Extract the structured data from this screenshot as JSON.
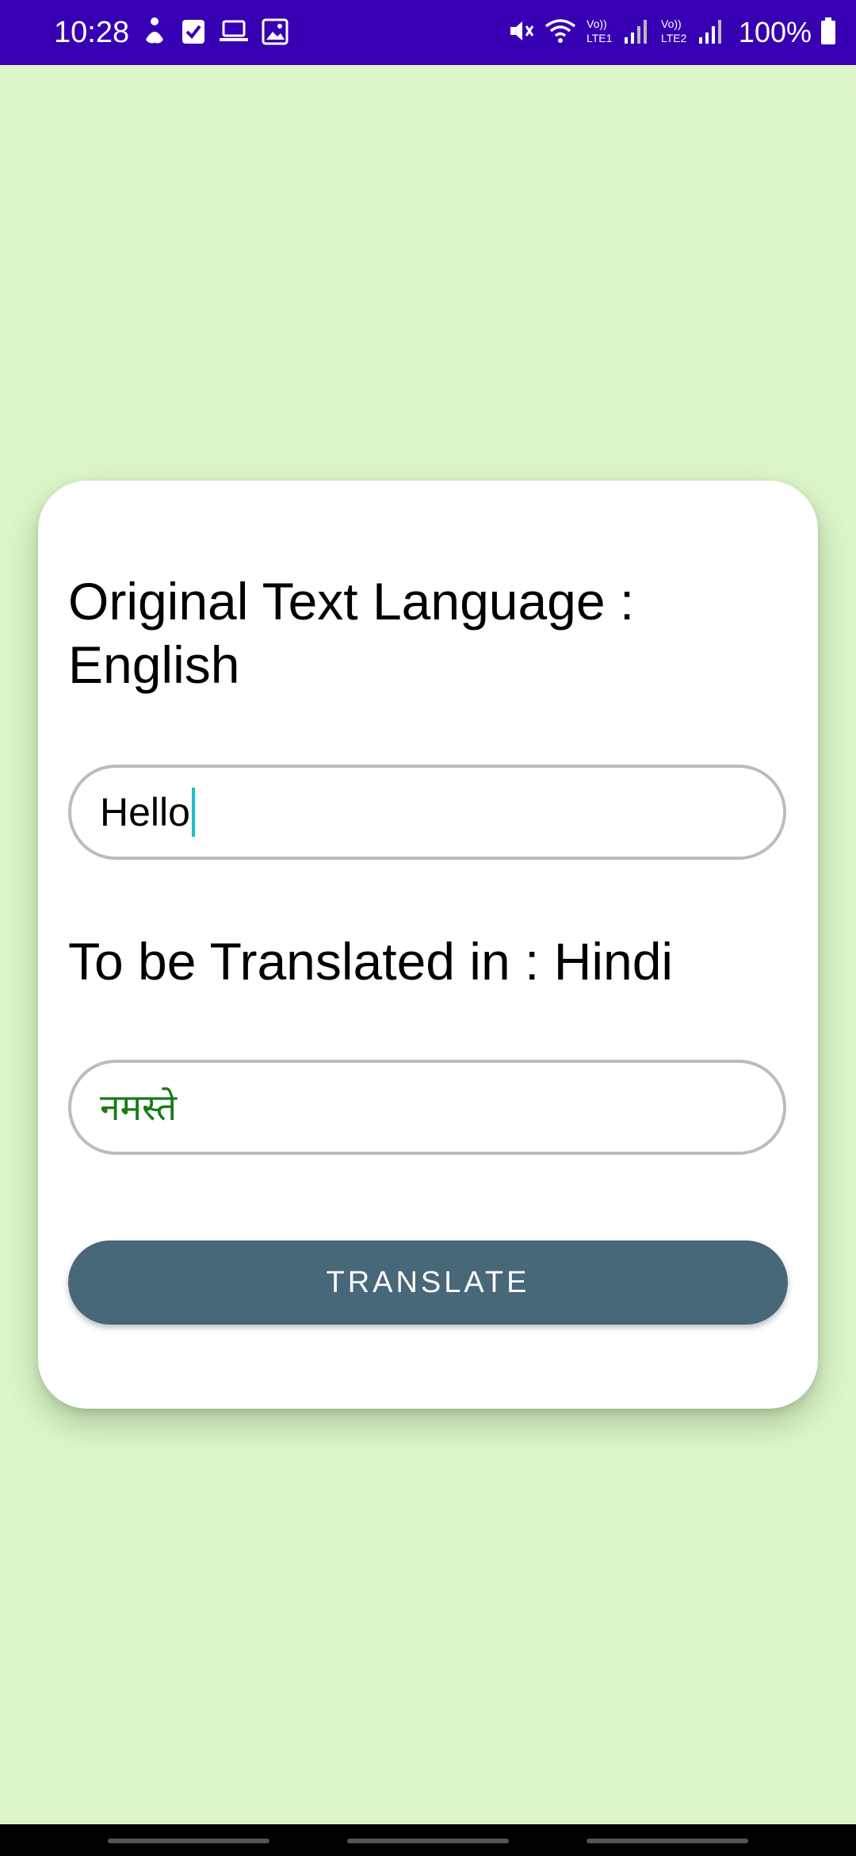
{
  "status_bar": {
    "time": "10:28",
    "battery": "100%",
    "background": "#3700b3",
    "left_icons": [
      "accessibility-icon",
      "checkbox-icon",
      "laptop-icon",
      "image-icon"
    ],
    "right_icons": [
      "mute-icon",
      "wifi-icon",
      "lte1-signal-icon",
      "lte2-signal-icon",
      "battery-icon"
    ],
    "lte1": "LTE1",
    "lte2": "LTE2",
    "volte": "Vo))"
  },
  "card": {
    "original_label": "Original Text Language : English",
    "input_value": "Hello",
    "target_label": "To be Translated in : Hindi",
    "output_value": "नमस्ते",
    "translate_button": "TRANSLATE"
  },
  "colors": {
    "page_background": "#dcf6ca",
    "button": "#486779",
    "output_text": "#177a17",
    "caret": "#1bbfc6"
  }
}
